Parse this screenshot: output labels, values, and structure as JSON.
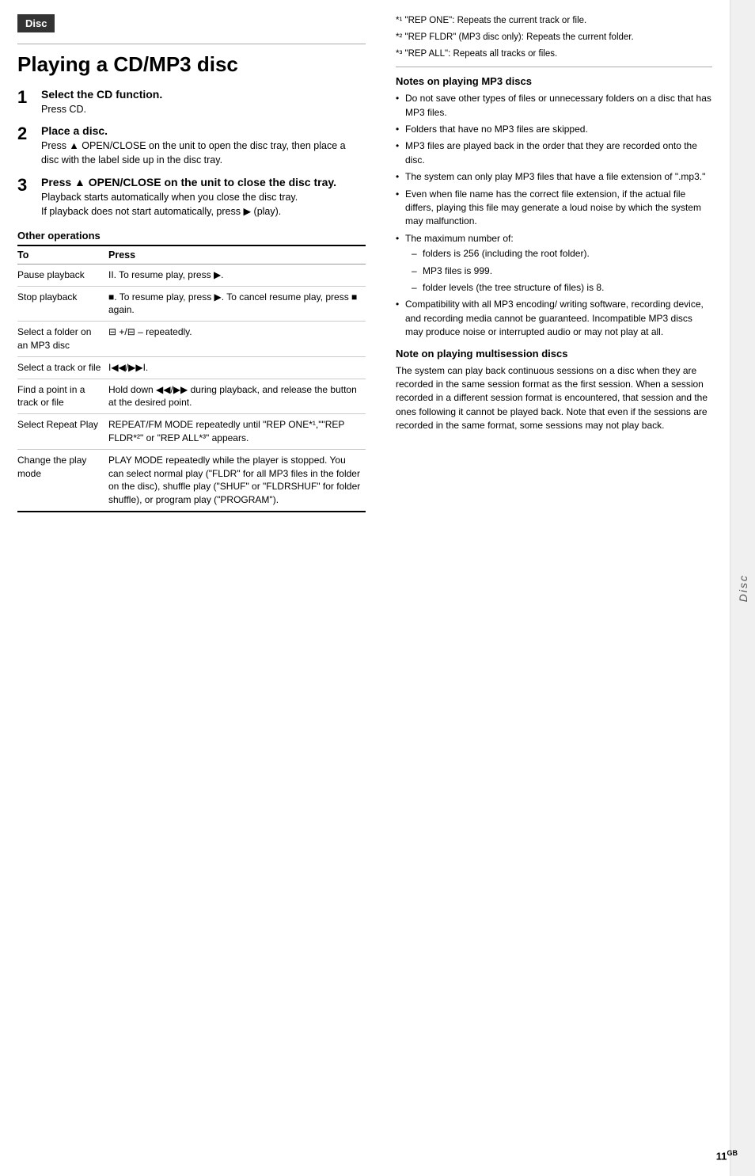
{
  "disc_tab": "Disc",
  "page_title": "Playing a CD/MP3 disc",
  "steps": [
    {
      "num": "1",
      "title": "Select the CD function.",
      "desc": "Press CD."
    },
    {
      "num": "2",
      "title": "Place a disc.",
      "desc": "Press ▲ OPEN/CLOSE on the unit to open the disc tray, then place a disc with the label side up in the disc tray."
    },
    {
      "num": "3",
      "title": "Press ▲ OPEN/CLOSE on the unit to close the disc tray.",
      "desc": "Playback starts automatically when you close the disc tray.\nIf playback does not start automatically, press ▶ (play)."
    }
  ],
  "other_ops_title": "Other operations",
  "ops_table_headers": [
    "To",
    "Press"
  ],
  "ops_table_rows": [
    {
      "to": "Pause playback",
      "press": "II. To resume play, press ▶."
    },
    {
      "to": "Stop playback",
      "press": "■. To resume play, press ▶. To cancel resume play, press ■ again."
    },
    {
      "to": "Select a folder on an MP3 disc",
      "press": "⊟ +/⊟ – repeatedly."
    },
    {
      "to": "Select a track or file",
      "press": "I◀◀/▶▶I."
    },
    {
      "to": "Find a point in a track or file",
      "press": "Hold down ◀◀/▶▶ during playback, and release the button at the desired point."
    },
    {
      "to": "Select Repeat Play",
      "press": "REPEAT/FM MODE repeatedly until \"REP ONE*¹,\"\"REP FLDR*²\" or \"REP ALL*³\" appears."
    },
    {
      "to": "Change the play mode",
      "press": "PLAY MODE repeatedly while the player is stopped. You can select normal play (\"FLDR\" for all MP3 files in the folder on the disc), shuffle play (\"SHUF\" or \"FLDRSHUF\" for folder shuffle), or program play (\"PROGRAM\")."
    }
  ],
  "footnotes": [
    "*¹ \"REP ONE\": Repeats the current track or file.",
    "*² \"REP FLDR\" (MP3 disc only): Repeats the current folder.",
    "*³ \"REP ALL\": Repeats all tracks or files."
  ],
  "notes_mp3_title": "Notes on playing MP3 discs",
  "notes_mp3": [
    "Do not save other types of files or unnecessary folders on a disc that has MP3 files.",
    "Folders that have no MP3 files are skipped.",
    "MP3 files are played back in the order that they are recorded onto the disc.",
    "The system can only play MP3 files that have a file extension of \".mp3.\"",
    "Even when file name has the correct file extension, if the actual file differs, playing this file may generate a loud noise by which the system may malfunction.",
    "The maximum number of:",
    "Compatibility with all MP3 encoding/ writing software, recording device, and recording media cannot be guaranteed. Incompatible MP3 discs may produce noise or interrupted audio or may not play at all."
  ],
  "max_number_sub": [
    "folders is 256 (including the root folder).",
    "MP3 files is 999.",
    "folder levels (the tree structure of files) is 8."
  ],
  "note_multisession_title": "Note on playing multisession discs",
  "note_multisession_text": "The system can play back continuous sessions on a disc when they are recorded in the same session format as the first session. When a session recorded in a different session format is encountered, that session and the ones following it cannot be played back. Note that even if the sessions are recorded in the same format, some sessions may not play back.",
  "side_label": "Disc",
  "page_number": "11",
  "page_num_suffix": "GB"
}
